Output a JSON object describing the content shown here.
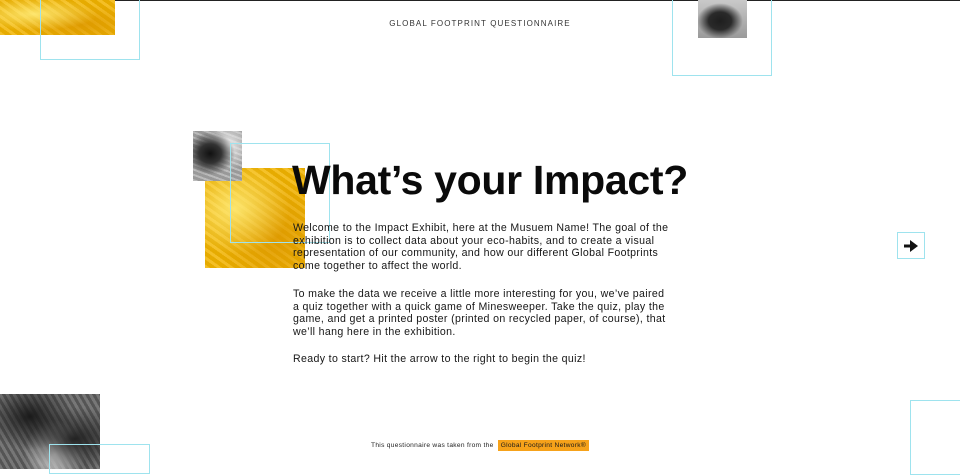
{
  "header": {
    "title": "GLOBAL FOOTPRINT QUESTIONNAIRE"
  },
  "main": {
    "headline": "What’s your Impact?",
    "paragraph_1": "Welcome to the Impact Exhibit, here at the Musuem Name! The goal of the exhibition is to collect data about your eco-habits, and to create a visual representation of our community, and how our different Global Footprints come together to affect the world.",
    "paragraph_2": "To make the data we receive a little more interesting for you, we’ve paired a quiz together with a quick game of Minesweeper. Take the quiz, play the game, and get a printed poster (printed on recycled paper, of course), that we’ll hang here in the exhibition.",
    "paragraph_3": "Ready to start? Hit the arrow to the right to begin the quiz!"
  },
  "navigation": {
    "next_icon": "arrow-right-icon"
  },
  "footer": {
    "text": "This questionnaire was taken from the",
    "link_label": "Global Footprint Network®"
  },
  "colors": {
    "accent_outline": "#9ee3ee",
    "gold": "#f2b400",
    "link_highlight": "#f6a21a"
  }
}
